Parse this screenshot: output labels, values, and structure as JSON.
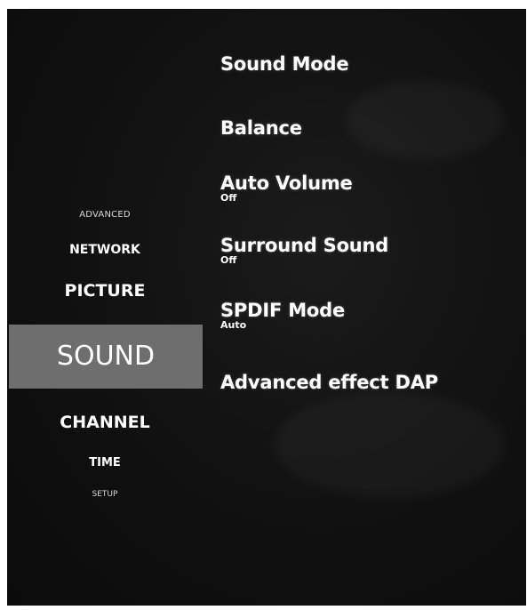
{
  "categories": {
    "advanced": "ADVANCED",
    "network": "NETWORK",
    "picture": "PICTURE",
    "sound": "SOUND",
    "channel": "CHANNEL",
    "time": "TIME",
    "setup": "SETUP",
    "selected": "SOUND"
  },
  "settings": [
    {
      "label": "Sound Mode",
      "value": ""
    },
    {
      "label": "Balance",
      "value": ""
    },
    {
      "label": "Auto Volume",
      "value": "Off"
    },
    {
      "label": "Surround Sound",
      "value": "Off"
    },
    {
      "label": "SPDIF Mode",
      "value": "Auto"
    },
    {
      "label": "Advanced effect DAP",
      "value": ""
    }
  ],
  "colors": {
    "background": "#121212",
    "highlight": "#6e6e6e",
    "text": "#ffffff"
  }
}
